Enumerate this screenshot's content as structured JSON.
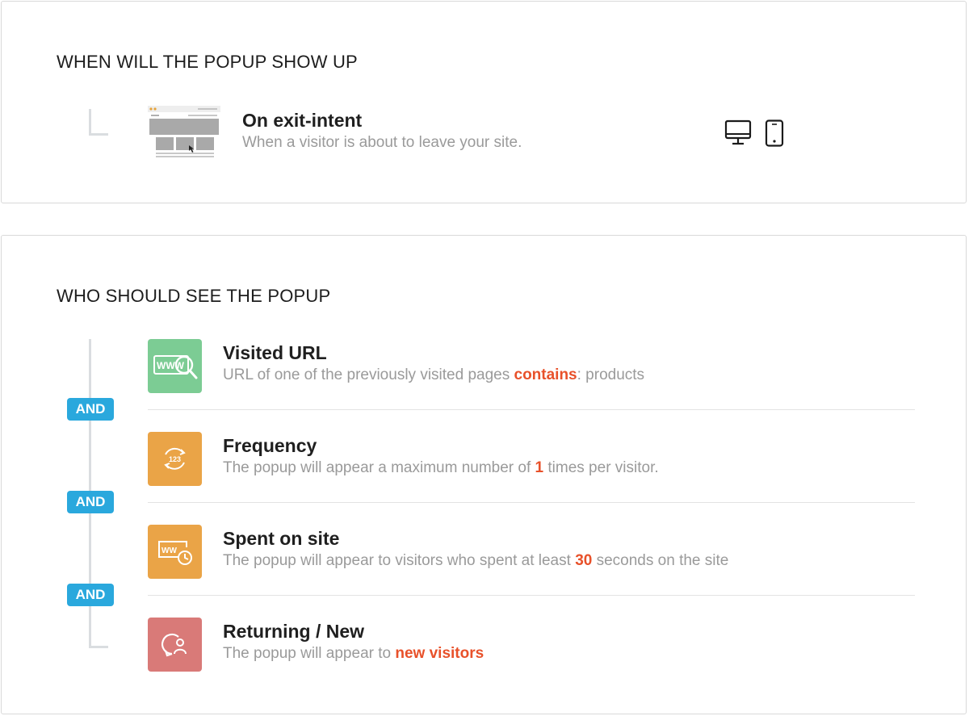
{
  "when_section": {
    "title": "WHEN WILL THE POPUP SHOW UP",
    "trigger": {
      "title": "On exit-intent",
      "description": "When a visitor is about to leave your site.",
      "thumbnail_icon": "exit-intent-page-thumbnail",
      "devices": [
        "desktop-icon",
        "mobile-icon"
      ]
    }
  },
  "who_section": {
    "title": "WHO SHOULD SEE THE POPUP",
    "connector_label": "AND",
    "conditions": [
      {
        "title": "Visited URL",
        "icon": "www-search-icon",
        "icon_color": "#7ccc94",
        "desc_before": "URL of one of the previously visited pages ",
        "desc_highlight": "contains",
        "desc_after": ": products"
      },
      {
        "title": "Frequency",
        "icon": "frequency-123-icon",
        "icon_color": "#eaa447",
        "desc_before": "The popup will appear a maximum number of ",
        "desc_highlight": "1",
        "desc_after": " times per visitor."
      },
      {
        "title": "Spent on site",
        "icon": "time-on-site-icon",
        "icon_color": "#eaa447",
        "desc_before": "The popup will appear to visitors who spent at least ",
        "desc_highlight": "30",
        "desc_after": " seconds on the site"
      },
      {
        "title": "Returning / New",
        "icon": "returning-visitor-icon",
        "icon_color": "#d97a78",
        "desc_before": "The popup will appear to ",
        "desc_highlight": "new visitors",
        "desc_after": ""
      }
    ]
  },
  "colors": {
    "highlight": "#e8512a",
    "and_badge": "#2aa8dd",
    "connector_line": "#dadde0"
  }
}
